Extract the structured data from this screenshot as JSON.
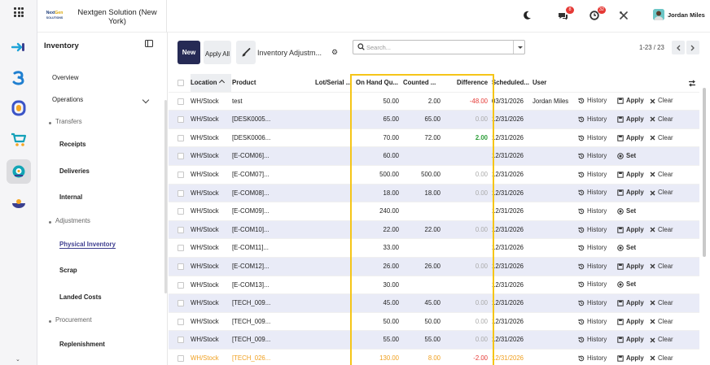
{
  "rail": {
    "icons": [
      "apps-grid-icon",
      "move-app-icon",
      "three-app-icon",
      "sync-app-icon",
      "cart-app-icon",
      "inventory-app-icon",
      "planning-app-icon"
    ]
  },
  "topbar": {
    "company": "Nextgen Solution (New York)",
    "logo_text": "NextGen SOLUTIONS",
    "messages_count": "8",
    "activity_count": "32",
    "user_name": "Jordan Miles"
  },
  "sidebar": {
    "title": "Inventory",
    "items": [
      {
        "label": "Overview",
        "kind": "top"
      },
      {
        "label": "Operations",
        "kind": "top"
      },
      {
        "label": "Transfers",
        "kind": "cat"
      },
      {
        "label": "Receipts",
        "kind": "sub"
      },
      {
        "label": "Deliveries",
        "kind": "sub"
      },
      {
        "label": "Internal",
        "kind": "sub"
      },
      {
        "label": "Adjustments",
        "kind": "cat"
      },
      {
        "label": "Physical Inventory",
        "kind": "sub"
      },
      {
        "label": "Scrap",
        "kind": "sub"
      },
      {
        "label": "Landed Costs",
        "kind": "sub"
      },
      {
        "label": "Procurement",
        "kind": "cat"
      },
      {
        "label": "Replenishment",
        "kind": "sub"
      }
    ]
  },
  "toolbar": {
    "new_label": "New",
    "apply_all_label": "Apply All",
    "view_title": "Inventory Adjustm...",
    "search_placeholder": "Search...",
    "pager_text": "1-23 / 23"
  },
  "table": {
    "headers": {
      "location": "Location",
      "product": "Product",
      "lot": "Lot/Serial ...",
      "on_hand": "On Hand Qu...",
      "counted": "Counted ...",
      "difference": "Difference",
      "scheduled": "Scheduled...",
      "user": "User"
    },
    "rows": [
      {
        "location": "WH/Stock",
        "product": "test",
        "on_hand": "50.00",
        "counted": "2.00",
        "diff": "-48.00",
        "diff_style": "red",
        "date": "03/31/2026",
        "user": "Jordan Miles",
        "action": "apply"
      },
      {
        "location": "WH/Stock",
        "product": "[DESK0005...",
        "on_hand": "65.00",
        "counted": "65.00",
        "diff": "0.00",
        "diff_style": "zero",
        "date": "12/31/2026",
        "user": "",
        "action": "apply"
      },
      {
        "location": "WH/Stock",
        "product": "[DESK0006...",
        "on_hand": "70.00",
        "counted": "72.00",
        "diff": "2.00",
        "diff_style": "green",
        "date": "12/31/2026",
        "user": "",
        "action": "apply"
      },
      {
        "location": "WH/Stock",
        "product": "[E-COM06]...",
        "on_hand": "60.00",
        "counted": "",
        "diff": "",
        "diff_style": "",
        "date": "12/31/2026",
        "user": "",
        "action": "set"
      },
      {
        "location": "WH/Stock",
        "product": "[E-COM07]...",
        "on_hand": "500.00",
        "counted": "500.00",
        "diff": "0.00",
        "diff_style": "zero",
        "date": "12/31/2026",
        "user": "",
        "action": "apply"
      },
      {
        "location": "WH/Stock",
        "product": "[E-COM08]...",
        "on_hand": "18.00",
        "counted": "18.00",
        "diff": "0.00",
        "diff_style": "zero",
        "date": "12/31/2026",
        "user": "",
        "action": "apply"
      },
      {
        "location": "WH/Stock",
        "product": "[E-COM09]...",
        "on_hand": "240.00",
        "counted": "",
        "diff": "",
        "diff_style": "",
        "date": "12/31/2026",
        "user": "",
        "action": "set"
      },
      {
        "location": "WH/Stock",
        "product": "[E-COM10]...",
        "on_hand": "22.00",
        "counted": "22.00",
        "diff": "0.00",
        "diff_style": "zero",
        "date": "12/31/2026",
        "user": "",
        "action": "apply"
      },
      {
        "location": "WH/Stock",
        "product": "[E-COM11]...",
        "on_hand": "33.00",
        "counted": "",
        "diff": "",
        "diff_style": "",
        "date": "12/31/2026",
        "user": "",
        "action": "set"
      },
      {
        "location": "WH/Stock",
        "product": "[E-COM12]...",
        "on_hand": "26.00",
        "counted": "26.00",
        "diff": "0.00",
        "diff_style": "zero",
        "date": "12/31/2026",
        "user": "",
        "action": "apply"
      },
      {
        "location": "WH/Stock",
        "product": "[E-COM13]...",
        "on_hand": "30.00",
        "counted": "",
        "diff": "",
        "diff_style": "",
        "date": "12/31/2026",
        "user": "",
        "action": "set"
      },
      {
        "location": "WH/Stock",
        "product": "[TECH_009...",
        "on_hand": "45.00",
        "counted": "45.00",
        "diff": "0.00",
        "diff_style": "zero",
        "date": "12/31/2026",
        "user": "",
        "action": "apply"
      },
      {
        "location": "WH/Stock",
        "product": "[TECH_009...",
        "on_hand": "50.00",
        "counted": "50.00",
        "diff": "0.00",
        "diff_style": "zero",
        "date": "12/31/2026",
        "user": "",
        "action": "apply"
      },
      {
        "location": "WH/Stock",
        "product": "[TECH_009...",
        "on_hand": "55.00",
        "counted": "55.00",
        "diff": "0.00",
        "diff_style": "zero",
        "date": "12/31/2026",
        "user": "",
        "action": "apply"
      },
      {
        "location": "WH/Stock",
        "product": "[TECH_026...",
        "on_hand": "130.00",
        "counted": "8.00",
        "diff": "-2.00",
        "diff_style": "red",
        "date": "12/31/2026",
        "user": "",
        "action": "apply",
        "warn": true
      }
    ]
  },
  "actions": {
    "history": "History",
    "apply": "Apply",
    "clear": "Clear",
    "set": "Set"
  },
  "colors": {
    "primary": "#262a55",
    "highlight": "#f5c518",
    "negative": "#e53935",
    "positive": "#2e9e3a",
    "warning": "#f0a020",
    "row_alt": "#e9ebf7"
  }
}
